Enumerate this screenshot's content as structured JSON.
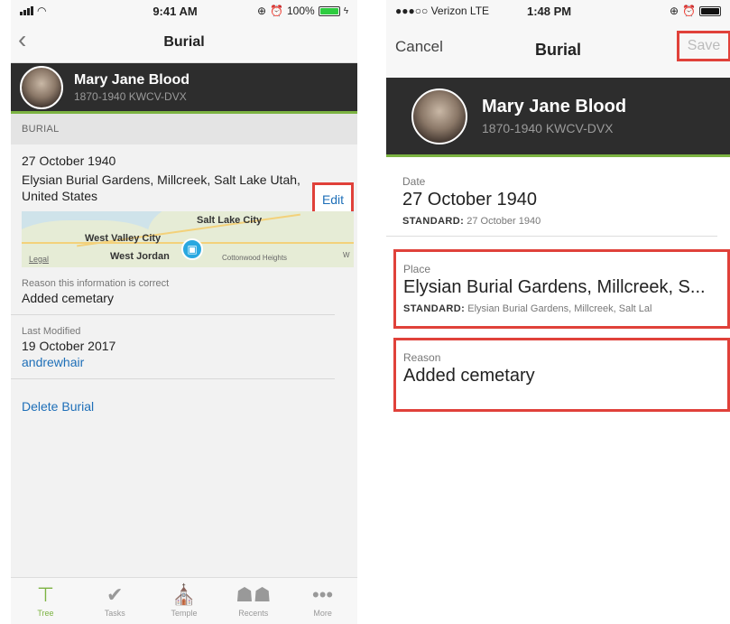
{
  "left": {
    "status": {
      "time": "9:41 AM",
      "battery": "100%"
    },
    "nav": {
      "title": "Burial"
    },
    "person": {
      "name": "Mary Jane Blood",
      "details": "1870-1940  KWCV-DVX"
    },
    "section": "BURIAL",
    "event": {
      "date": "27 October 1940",
      "place": "Elysian Burial Gardens, Millcreek, Salt Lake Utah, United States",
      "edit_label": "Edit"
    },
    "map": {
      "labels": [
        "Salt Lake City",
        "West Valley City",
        "West Jordan",
        "Cottonwood Heights"
      ],
      "legal": "Legal",
      "edge_label": "W"
    },
    "reason": {
      "label": "Reason this information is correct",
      "value": "Added cemetary"
    },
    "modified": {
      "label": "Last Modified",
      "date": "19 October 2017",
      "user": "andrewhair"
    },
    "delete_label": "Delete Burial",
    "tabs": [
      {
        "label": "Tree",
        "icon": "tree-icon"
      },
      {
        "label": "Tasks",
        "icon": "checkmark-icon"
      },
      {
        "label": "Temple",
        "icon": "temple-icon"
      },
      {
        "label": "Recents",
        "icon": "people-icon"
      },
      {
        "label": "More",
        "icon": "ellipsis-icon"
      }
    ]
  },
  "right": {
    "status": {
      "carrier": "●●●○○ Verizon  LTE",
      "time": "1:48 PM"
    },
    "nav": {
      "cancel": "Cancel",
      "title": "Burial",
      "save": "Save"
    },
    "person": {
      "name": "Mary Jane Blood",
      "details": "1870-1940  KWCV-DVX"
    },
    "date": {
      "label": "Date",
      "value": "27 October 1940",
      "standard_label": "STANDARD:",
      "standard_value": "27 October 1940"
    },
    "place": {
      "label": "Place",
      "value": "Elysian Burial Gardens, Millcreek, S...",
      "standard_label": "STANDARD:",
      "standard_value": "Elysian Burial Gardens, Millcreek, Salt Lal"
    },
    "reason": {
      "label": "Reason",
      "value": "Added cemetary"
    }
  },
  "colors": {
    "accent_green": "#7cb342",
    "link_blue": "#1e6fb8",
    "highlight_red": "#e0413a",
    "header_dark": "#2d2d2d"
  }
}
